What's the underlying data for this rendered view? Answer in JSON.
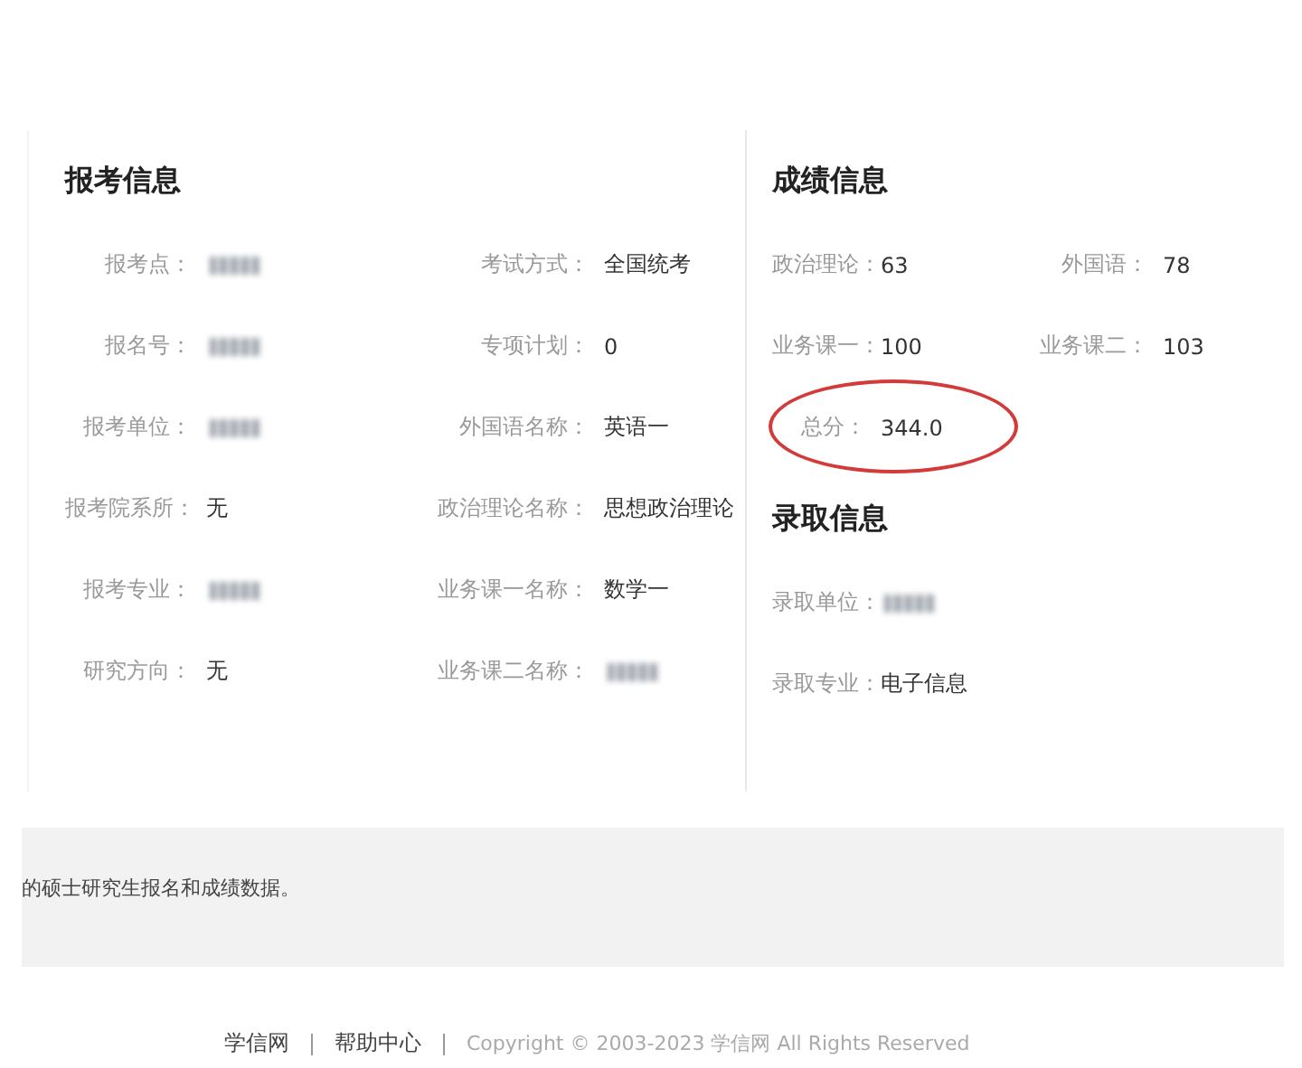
{
  "registration": {
    "title": "报考信息",
    "rows": [
      [
        {
          "label": "报考点：",
          "blurred": true
        },
        {
          "label": "考试方式：",
          "value": "全国统考"
        }
      ],
      [
        {
          "label": "报名号：",
          "blurred": true
        },
        {
          "label": "专项计划：",
          "value": "0"
        }
      ],
      [
        {
          "label": "报考单位：",
          "blurred": true
        },
        {
          "label": "外国语名称：",
          "value": "英语一"
        }
      ],
      [
        {
          "label": "报考院系所：",
          "value": "无"
        },
        {
          "label": "政治理论名称：",
          "value": "思想政治理论"
        }
      ],
      [
        {
          "label": "报考专业：",
          "blurred": true
        },
        {
          "label": "业务课一名称：",
          "value": "数学一"
        }
      ],
      [
        {
          "label": "研究方向：",
          "value": "无"
        },
        {
          "label": "业务课二名称：",
          "blurred": true
        }
      ]
    ]
  },
  "scores": {
    "title": "成绩信息",
    "rows": [
      [
        {
          "label": "政治理论：",
          "value": "63"
        },
        {
          "label": "外国语：",
          "value": "78"
        }
      ],
      [
        {
          "label": "业务课一：",
          "value": "100"
        },
        {
          "label": "业务课二：",
          "value": "103"
        }
      ],
      [
        {
          "label": "总分：",
          "value": "344.0",
          "circled": true
        }
      ]
    ]
  },
  "admission": {
    "title": "录取信息",
    "rows": [
      [
        {
          "label": "录取单位：",
          "blurred": true
        }
      ],
      [
        {
          "label": "录取专业：",
          "value": "电子信息"
        }
      ]
    ]
  },
  "notice": "的硕士研究生报名和成绩数据。",
  "footer": {
    "links": [
      "学信网",
      "帮助中心"
    ],
    "copyright": "Copyright © 2003-2023 学信网 All Rights Reserved"
  }
}
